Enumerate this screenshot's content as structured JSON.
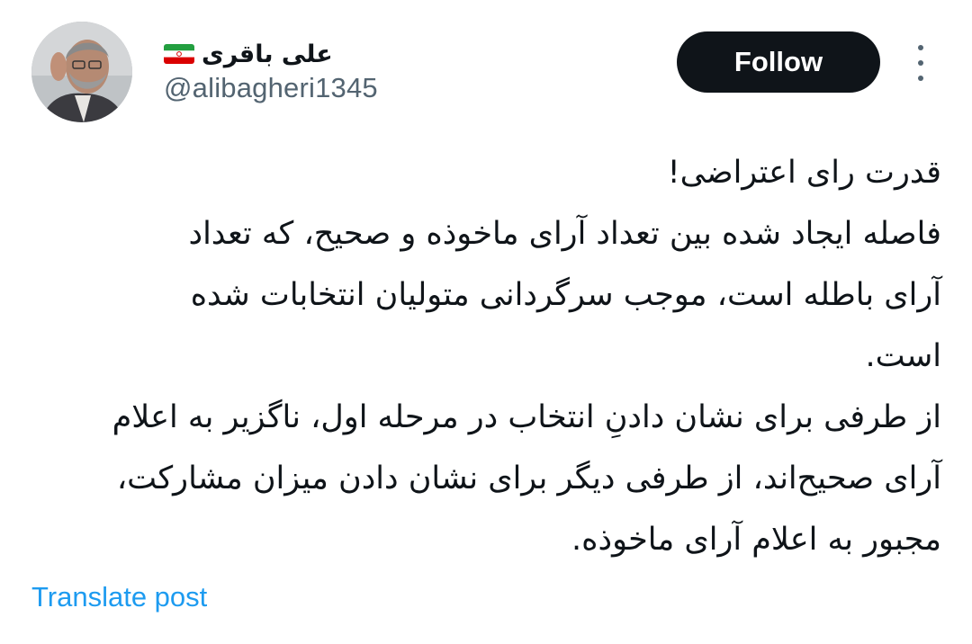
{
  "author": {
    "display_name": "علی باقری",
    "flag_icon": "iran-flag-icon",
    "handle": "@alibagheri1345",
    "avatar_icon": "profile-photo"
  },
  "actions": {
    "follow_label": "Follow",
    "more_icon": "more-vertical-icon"
  },
  "tweet": {
    "lines": [
      "قدرت رای اعتراضی!",
      "فاصله ایجاد شده بین تعداد آرای ماخوذه و صحیح، که تعداد",
      "آرای باطله است، موجب سرگردانی متولیان انتخابات شده",
      "است.",
      "از طرفی برای نشان دادنِ انتخاب در مرحله اول، ناگزیر به اعلام",
      "آرای صحیح‌اند، از طرفی دیگر برای نشان دادن میزان مشارکت،",
      "مجبور به اعلام آرای ماخوذه."
    ]
  },
  "translate_label": "Translate post",
  "colors": {
    "text": "#0f1419",
    "secondary": "#536471",
    "link": "#1d9bf0",
    "button_bg": "#0f1419"
  }
}
